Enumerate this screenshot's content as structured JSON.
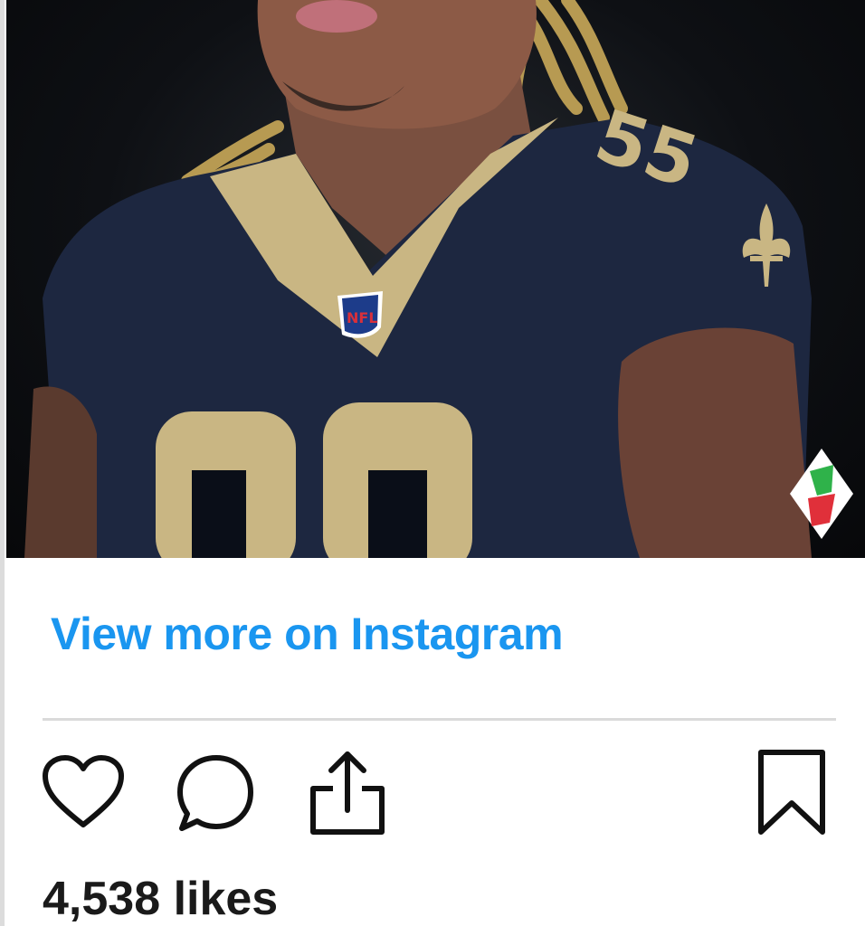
{
  "post": {
    "image_alt": "Football player in navy and gold jersey",
    "watermark_logo": "PR-logo",
    "view_more_label": "View more on Instagram",
    "likes_text": "4,538 likes"
  },
  "actions": {
    "like_icon": "heart-icon",
    "comment_icon": "comment-icon",
    "share_icon": "share-icon",
    "save_icon": "bookmark-icon"
  },
  "colors": {
    "link_blue": "#1a96f0",
    "jersey_navy": "#1d2740",
    "jersey_gold": "#c9b683",
    "divider": "#dadada"
  }
}
